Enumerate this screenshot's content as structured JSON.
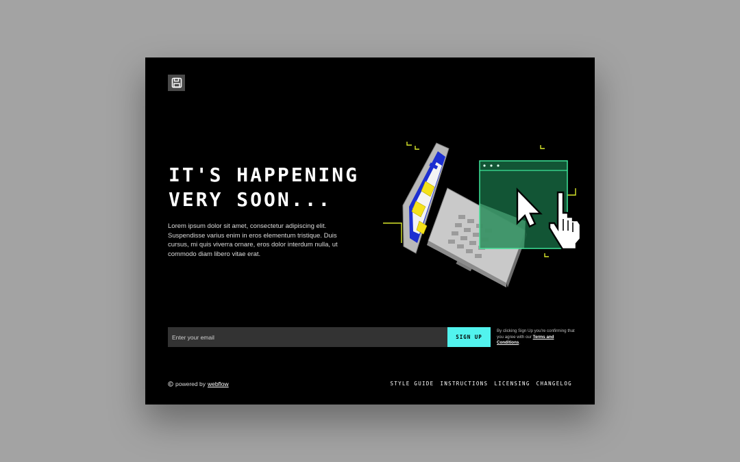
{
  "logo": {
    "icon": "floppy-disk-icon"
  },
  "hero": {
    "title_line1": "IT'S HAPPENING",
    "title_line2": "VERY SOON...",
    "description": "Lorem ipsum dolor sit amet, consectetur adipiscing elit. Suspendisse varius enim in eros elementum tristique. Duis cursus, mi quis viverra ornare, eros dolor interdum nulla, ut commodo diam libero vitae erat."
  },
  "illustration": {
    "icon": "retro-laptop-browser-cursor-illustration"
  },
  "signup": {
    "email_placeholder": "Enter your email",
    "email_value": "",
    "button_label": "SIGN UP",
    "legal_prefix": "By clicking Sign Up you're confirming that you agree with our ",
    "legal_link": "Terms and Conditions",
    "legal_suffix": "."
  },
  "footer": {
    "powered_icon": "copyright-icon",
    "powered_prefix": "powered by",
    "powered_link": "webflow",
    "nav": [
      "STYLE GUIDE",
      "INSTRUCTIONS",
      "LICENSING",
      "CHANGELOG"
    ]
  },
  "colors": {
    "page_bg": "#a3a3a3",
    "card_bg": "#000000",
    "accent_cyan": "#52f3ee",
    "accent_green": "#3ee59a",
    "accent_yellow": "#d9e82b",
    "input_bg": "#333333"
  }
}
